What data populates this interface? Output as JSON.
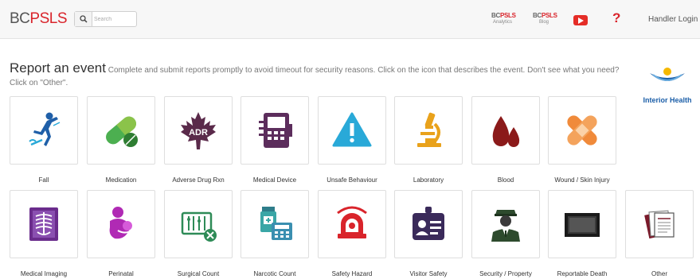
{
  "nav": {
    "brand_bc": "BC",
    "brand_psls": "PSLS",
    "search_placeholder": "Search",
    "analytics": {
      "title_a": "BC",
      "title_b": "PSLS",
      "sub": "Analytics"
    },
    "blog": {
      "title_a": "BC",
      "title_b": "PSLS",
      "sub": "Blog"
    },
    "help": "?",
    "login": "Handler Login"
  },
  "header": {
    "title": "Report an event",
    "subtitle": "Complete and submit reports promptly to avoid timeout for security reasons. Click on the icon that describes the event. Don't see what you need? Click on \"Other\"."
  },
  "logo": {
    "text": "Interior Health"
  },
  "icons_row1": {
    "adr": "ADR"
  },
  "events": [
    {
      "label": "Fall",
      "icon": "fall-icon"
    },
    {
      "label": "Medication",
      "icon": "pill-icon"
    },
    {
      "label": "Adverse Drug Rxn",
      "icon": "maple-leaf-icon"
    },
    {
      "label": "Medical Device",
      "icon": "medical-device-icon"
    },
    {
      "label": "Unsafe Behaviour",
      "icon": "warning-icon"
    },
    {
      "label": "Laboratory",
      "icon": "microscope-icon"
    },
    {
      "label": "Blood",
      "icon": "blood-drop-icon"
    },
    {
      "label": "Wound / Skin Injury",
      "icon": "bandage-icon"
    },
    {
      "label": "Medical Imaging",
      "icon": "xray-icon"
    },
    {
      "label": "Perinatal",
      "icon": "mother-baby-icon"
    },
    {
      "label": "Surgical Count",
      "icon": "surgical-tools-icon"
    },
    {
      "label": "Narcotic Count",
      "icon": "calculator-bottle-icon"
    },
    {
      "label": "Safety Hazard",
      "icon": "siren-icon"
    },
    {
      "label": "Visitor Safety",
      "icon": "id-badge-icon"
    },
    {
      "label": "Security / Property",
      "icon": "security-guard-icon"
    },
    {
      "label": "Reportable Death",
      "icon": "black-frame-icon"
    },
    {
      "label": "Other",
      "icon": "documents-icon"
    }
  ],
  "colors": {
    "brand_red": "#d9242b",
    "fall_blue": "#1f5fa8",
    "medication_green": "#4caf50",
    "adr_purple": "#5a2a4a",
    "device_purple": "#5c2d5c",
    "warning_cyan": "#29a9d8",
    "lab_gold": "#e9a21b",
    "blood_red": "#8b1a1a",
    "bandage_orange": "#f08a3a",
    "perinatal_magenta": "#b02ab4",
    "surgical_green": "#2e8b57",
    "narcotic_teal": "#3aa6a6"
  }
}
